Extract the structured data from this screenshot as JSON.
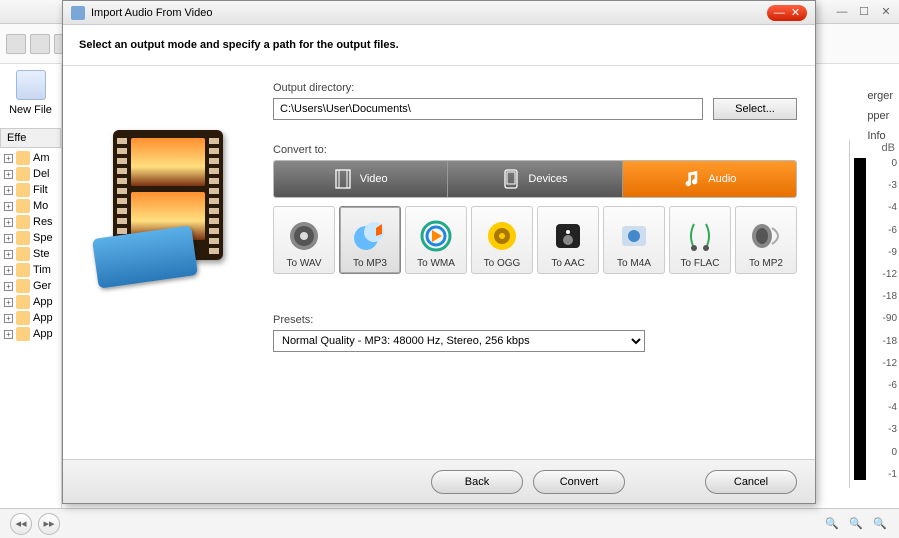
{
  "main": {
    "newfile_label": "New File",
    "effects_header": "Effe",
    "tree_items": [
      "Am",
      "Del",
      "Filt",
      "Mo",
      "Res",
      "Spe",
      "Ste",
      "Tim",
      "Ger",
      "App",
      "App",
      "App"
    ],
    "right_labels": [
      "erger",
      "pper",
      "Info"
    ],
    "meter_header": "dB",
    "meter_ticks": [
      "0",
      "-3",
      "-4",
      "-6",
      "-9",
      "-12",
      "-18",
      "-90",
      "-18",
      "-12",
      "-6",
      "-4",
      "-3",
      "0",
      "-1"
    ]
  },
  "dialog": {
    "title": "Import Audio From Video",
    "instruction": "Select an output mode and specify a path for the output files.",
    "output_dir_label": "Output directory:",
    "output_dir_value": "C:\\Users\\User\\Documents\\",
    "select_btn": "Select...",
    "convert_to_label": "Convert to:",
    "tabs": [
      {
        "label": "Video"
      },
      {
        "label": "Devices"
      },
      {
        "label": "Audio"
      }
    ],
    "formats": [
      {
        "label": "To WAV"
      },
      {
        "label": "To MP3"
      },
      {
        "label": "To WMA"
      },
      {
        "label": "To OGG"
      },
      {
        "label": "To AAC"
      },
      {
        "label": "To M4A"
      },
      {
        "label": "To FLAC"
      },
      {
        "label": "To MP2"
      }
    ],
    "presets_label": "Presets:",
    "preset_value": "Normal Quality - MP3: 48000 Hz, Stereo, 256 kbps",
    "buttons": {
      "back": "Back",
      "convert": "Convert",
      "cancel": "Cancel"
    }
  }
}
